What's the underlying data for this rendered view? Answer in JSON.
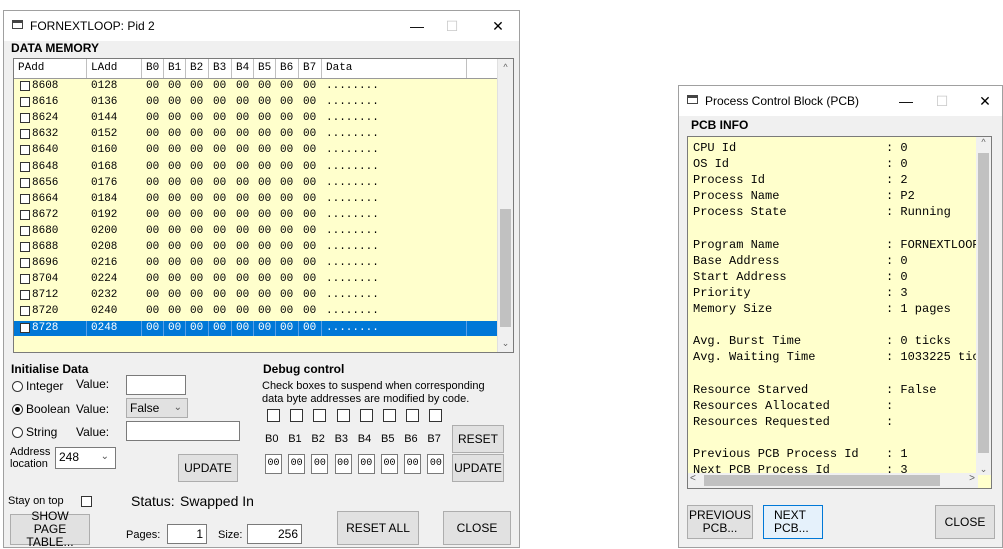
{
  "mem_window": {
    "title": "FORNEXTLOOP: Pid 2",
    "section_title": "DATA MEMORY",
    "columns": [
      "PAdd",
      "LAdd",
      "B0",
      "B1",
      "B2",
      "B3",
      "B4",
      "B5",
      "B6",
      "B7",
      "Data"
    ],
    "rows": [
      {
        "padd": "8608",
        "ladd": "0128",
        "bytes": [
          "00",
          "00",
          "00",
          "00",
          "00",
          "00",
          "00",
          "00"
        ],
        "data": "........"
      },
      {
        "padd": "8616",
        "ladd": "0136",
        "bytes": [
          "00",
          "00",
          "00",
          "00",
          "00",
          "00",
          "00",
          "00"
        ],
        "data": "........"
      },
      {
        "padd": "8624",
        "ladd": "0144",
        "bytes": [
          "00",
          "00",
          "00",
          "00",
          "00",
          "00",
          "00",
          "00"
        ],
        "data": "........"
      },
      {
        "padd": "8632",
        "ladd": "0152",
        "bytes": [
          "00",
          "00",
          "00",
          "00",
          "00",
          "00",
          "00",
          "00"
        ],
        "data": "........"
      },
      {
        "padd": "8640",
        "ladd": "0160",
        "bytes": [
          "00",
          "00",
          "00",
          "00",
          "00",
          "00",
          "00",
          "00"
        ],
        "data": "........"
      },
      {
        "padd": "8648",
        "ladd": "0168",
        "bytes": [
          "00",
          "00",
          "00",
          "00",
          "00",
          "00",
          "00",
          "00"
        ],
        "data": "........"
      },
      {
        "padd": "8656",
        "ladd": "0176",
        "bytes": [
          "00",
          "00",
          "00",
          "00",
          "00",
          "00",
          "00",
          "00"
        ],
        "data": "........"
      },
      {
        "padd": "8664",
        "ladd": "0184",
        "bytes": [
          "00",
          "00",
          "00",
          "00",
          "00",
          "00",
          "00",
          "00"
        ],
        "data": "........"
      },
      {
        "padd": "8672",
        "ladd": "0192",
        "bytes": [
          "00",
          "00",
          "00",
          "00",
          "00",
          "00",
          "00",
          "00"
        ],
        "data": "........"
      },
      {
        "padd": "8680",
        "ladd": "0200",
        "bytes": [
          "00",
          "00",
          "00",
          "00",
          "00",
          "00",
          "00",
          "00"
        ],
        "data": "........"
      },
      {
        "padd": "8688",
        "ladd": "0208",
        "bytes": [
          "00",
          "00",
          "00",
          "00",
          "00",
          "00",
          "00",
          "00"
        ],
        "data": "........"
      },
      {
        "padd": "8696",
        "ladd": "0216",
        "bytes": [
          "00",
          "00",
          "00",
          "00",
          "00",
          "00",
          "00",
          "00"
        ],
        "data": "........"
      },
      {
        "padd": "8704",
        "ladd": "0224",
        "bytes": [
          "00",
          "00",
          "00",
          "00",
          "00",
          "00",
          "00",
          "00"
        ],
        "data": "........"
      },
      {
        "padd": "8712",
        "ladd": "0232",
        "bytes": [
          "00",
          "00",
          "00",
          "00",
          "00",
          "00",
          "00",
          "00"
        ],
        "data": "........"
      },
      {
        "padd": "8720",
        "ladd": "0240",
        "bytes": [
          "00",
          "00",
          "00",
          "00",
          "00",
          "00",
          "00",
          "00"
        ],
        "data": "........"
      },
      {
        "padd": "8728",
        "ladd": "0248",
        "bytes": [
          "00",
          "00",
          "00",
          "00",
          "00",
          "00",
          "00",
          "00"
        ],
        "data": "........",
        "selected": true
      }
    ],
    "init": {
      "title": "Initialise Data",
      "integer_label": "Integer",
      "boolean_label": "Boolean",
      "string_label": "String",
      "value_label": "Value:",
      "boolean_value": "False",
      "integer_value": "",
      "string_value": "",
      "address_label_1": "Address",
      "address_label_2": "location",
      "address_value": "248",
      "update_label": "UPDATE",
      "selected_type": "Boolean"
    },
    "debug": {
      "title": "Debug control",
      "desc_1": "Check boxes to suspend when corresponding",
      "desc_2": "data byte addresses are modified by code.",
      "byte_labels": [
        "B0",
        "B1",
        "B2",
        "B3",
        "B4",
        "B5",
        "B6",
        "B7"
      ],
      "byte_values": [
        "00",
        "00",
        "00",
        "00",
        "00",
        "00",
        "00",
        "00"
      ],
      "reset_label": "RESET",
      "update_label": "UPDATE"
    },
    "bottom": {
      "stay_on_top": "Stay on top",
      "status_label": "Status:",
      "status_value": "Swapped In",
      "show_page_table": "SHOW PAGE TABLE...",
      "pages_label": "Pages:",
      "pages_value": "1",
      "size_label": "Size:",
      "size_value": "256",
      "reset_all": "RESET ALL",
      "close": "CLOSE"
    }
  },
  "pcb_window": {
    "title": "Process Control Block (PCB)",
    "section_title": "PCB INFO",
    "lines": [
      {
        "label": "CPU Id",
        "value": ": 0"
      },
      {
        "label": "OS Id",
        "value": ": 0"
      },
      {
        "label": "Process Id",
        "value": ": 2"
      },
      {
        "label": "Process Name",
        "value": ": P2"
      },
      {
        "label": "Process State",
        "value": ": Running"
      },
      {
        "label": "",
        "value": ""
      },
      {
        "label": "Program Name",
        "value": ": FORNEXTLOOP"
      },
      {
        "label": "Base Address",
        "value": ": 0"
      },
      {
        "label": "Start Address",
        "value": ": 0"
      },
      {
        "label": "Priority",
        "value": ": 3"
      },
      {
        "label": "Memory Size",
        "value": ": 1 pages"
      },
      {
        "label": "",
        "value": ""
      },
      {
        "label": "Avg. Burst Time",
        "value": ": 0 ticks"
      },
      {
        "label": "Avg. Waiting Time",
        "value": ": 1033225 tic"
      },
      {
        "label": "",
        "value": ""
      },
      {
        "label": "Resource Starved",
        "value": ": False"
      },
      {
        "label": "Resources Allocated",
        "value": ":"
      },
      {
        "label": "Resources Requested",
        "value": ":"
      },
      {
        "label": "",
        "value": ""
      },
      {
        "label": "Previous PCB Process Id",
        "value": ": 1"
      },
      {
        "label": "Next PCB Process Id",
        "value": ": 3"
      }
    ],
    "prev_label": "PREVIOUS PCB...",
    "next_label": "NEXT PCB...",
    "close_label": "CLOSE"
  },
  "colors": {
    "yellow_bg": "#ffffcc",
    "selection": "#0078d7",
    "window_bg": "#f0f0f0"
  }
}
